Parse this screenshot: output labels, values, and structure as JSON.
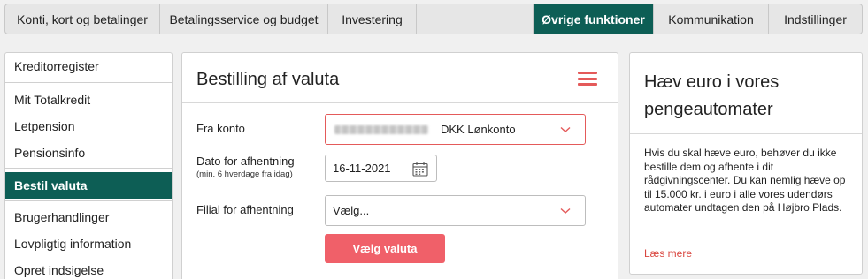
{
  "topnav": {
    "tabs": [
      {
        "label": "Konti, kort og betalinger"
      },
      {
        "label": "Betalingsservice og budget"
      },
      {
        "label": "Investering"
      },
      {
        "label": "Øvrige funktioner"
      },
      {
        "label": "Kommunikation"
      },
      {
        "label": "Indstillinger"
      }
    ],
    "active_tab": "Øvrige funktioner"
  },
  "sidebar": {
    "items": [
      {
        "label": "Kreditorregister"
      },
      {
        "label": "Mit Totalkredit"
      },
      {
        "label": "Letpension"
      },
      {
        "label": "Pensionsinfo"
      },
      {
        "label": "Bestil valuta"
      },
      {
        "label": "Brugerhandlinger"
      },
      {
        "label": "Lovpligtig information"
      },
      {
        "label": "Opret indsigelse"
      }
    ],
    "active_item": "Bestil valuta"
  },
  "form": {
    "title": "Bestilling af valuta",
    "from_account": {
      "label": "Fra konto",
      "account_name": "DKK Lønkonto"
    },
    "pickup_date": {
      "label": "Dato for afhentning",
      "hint": "(min. 6 hverdage fra idag)",
      "value": "16-11-2021"
    },
    "branch": {
      "label": "Filial for afhentning",
      "value": "Vælg..."
    },
    "submit_label": "Vælg valuta"
  },
  "info_card": {
    "title": "Hæv euro i vores pengeautomater",
    "body": "Hvis du skal hæve euro, behøver du ikke bestille dem og afhente i dit rådgivningscenter. Du kan nemlig hæve op til 15.000 kr. i euro i alle vores udendørs automater undtagen den på Højbro Plads.",
    "link_label": "Læs mere"
  },
  "colors": {
    "brand_green": "#0d5e55",
    "accent_red": "#f06069",
    "error_border": "#e45a5a",
    "link_red": "#d9463f"
  },
  "icons": {
    "menu": "hamburger-menu-icon",
    "dropdown": "chevron-down-icon",
    "calendar": "calendar-icon"
  }
}
